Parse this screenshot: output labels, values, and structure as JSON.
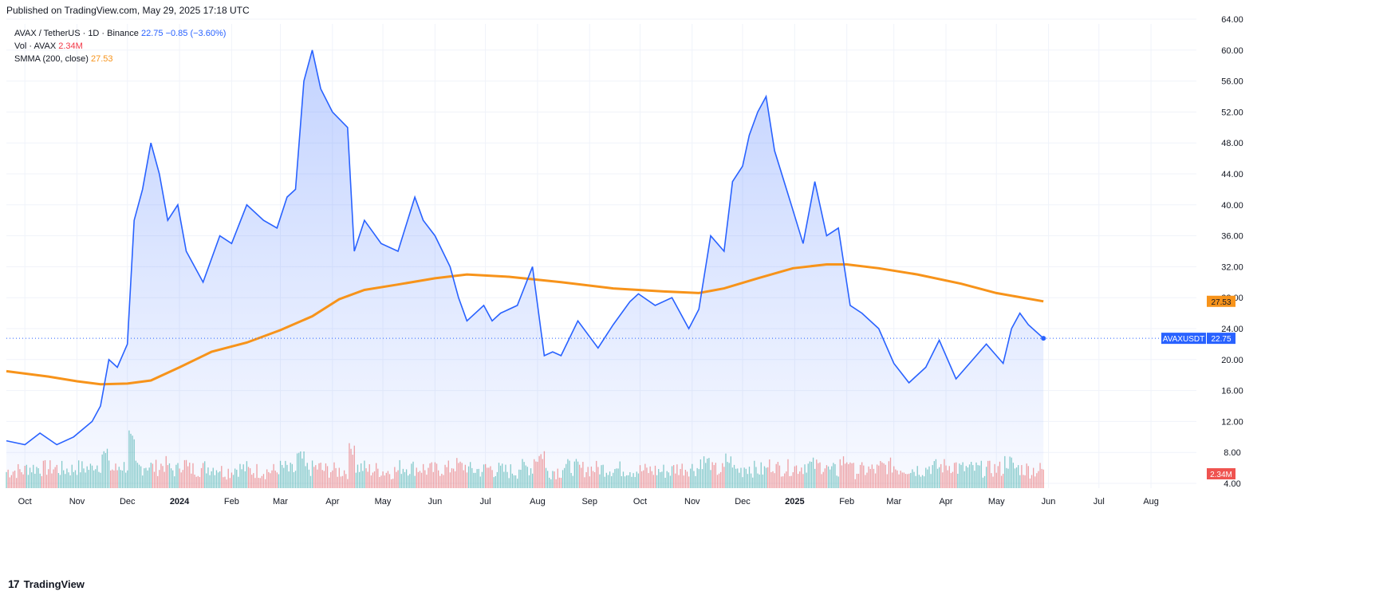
{
  "header": {
    "published": "Published on TradingView.com, May 29, 2025 17:18 UTC"
  },
  "legend": {
    "symbol": "AVAX / TetherUS · 1D · Binance",
    "price": "22.75",
    "change": "−0.85 (−3.60%)",
    "vol_label": "Vol · AVAX",
    "vol_value": "2.34M",
    "smma_label": "SMMA (200, close)",
    "smma_value": "27.53"
  },
  "branding": {
    "logo": "17",
    "name": "TradingView"
  },
  "colors": {
    "price_line": "#2962ff",
    "smma": "#f7931a",
    "vol_up": "#26a69a",
    "vol_down": "#ef5350",
    "grid": "#f0f3fa",
    "axis_text": "#131722"
  },
  "chart_data": {
    "type": "area",
    "symbol": "AVAXUSDT",
    "y_axis": {
      "ticks": [
        "64.00",
        "60.00",
        "56.00",
        "52.00",
        "48.00",
        "44.00",
        "40.00",
        "36.00",
        "32.00",
        "28.00",
        "24.00",
        "20.00",
        "16.00",
        "12.00",
        "8.00",
        "4.00"
      ],
      "ylim": [
        4,
        64
      ]
    },
    "x_axis": {
      "ticks": [
        "Oct",
        "Nov",
        "Dec",
        "2024",
        "Feb",
        "Mar",
        "Apr",
        "May",
        "Jun",
        "Jul",
        "Aug",
        "Sep",
        "Oct",
        "Nov",
        "Dec",
        "2025",
        "Feb",
        "Mar",
        "Apr",
        "May",
        "Jun",
        "Jul",
        "Aug"
      ],
      "tick_dates": [
        "2023-10-01",
        "2023-11-01",
        "2023-12-01",
        "2024-01-01",
        "2024-02-01",
        "2024-03-01",
        "2024-04-01",
        "2024-05-01",
        "2024-06-01",
        "2024-07-01",
        "2024-08-01",
        "2024-09-01",
        "2024-10-01",
        "2024-11-01",
        "2024-12-01",
        "2025-01-01",
        "2025-02-01",
        "2025-03-01",
        "2025-04-01",
        "2025-05-01",
        "2025-06-01",
        "2025-07-01",
        "2025-08-01"
      ],
      "range": [
        "2023-09-20",
        "2025-08-28"
      ]
    },
    "price_labels": {
      "current": "22.75",
      "ticker": "AVAXUSDT",
      "smma": "27.53",
      "volume": "2.34M"
    },
    "series": [
      {
        "name": "AVAX / TetherUS",
        "x": [
          "2023-09-20",
          "2023-10-01",
          "2023-10-10",
          "2023-10-20",
          "2023-10-30",
          "2023-11-10",
          "2023-11-15",
          "2023-11-20",
          "2023-11-25",
          "2023-12-01",
          "2023-12-05",
          "2023-12-10",
          "2023-12-15",
          "2023-12-20",
          "2023-12-25",
          "2023-12-31",
          "2024-01-05",
          "2024-01-15",
          "2024-01-25",
          "2024-02-01",
          "2024-02-10",
          "2024-02-20",
          "2024-02-28",
          "2024-03-05",
          "2024-03-10",
          "2024-03-15",
          "2024-03-20",
          "2024-03-25",
          "2024-04-01",
          "2024-04-10",
          "2024-04-14",
          "2024-04-20",
          "2024-04-30",
          "2024-05-10",
          "2024-05-20",
          "2024-05-25",
          "2024-06-01",
          "2024-06-10",
          "2024-06-15",
          "2024-06-20",
          "2024-06-30",
          "2024-07-05",
          "2024-07-10",
          "2024-07-20",
          "2024-07-29",
          "2024-08-05",
          "2024-08-10",
          "2024-08-15",
          "2024-08-25",
          "2024-09-06",
          "2024-09-15",
          "2024-09-25",
          "2024-09-30",
          "2024-10-10",
          "2024-10-20",
          "2024-10-30",
          "2024-11-05",
          "2024-11-12",
          "2024-11-20",
          "2024-11-25",
          "2024-12-01",
          "2024-12-05",
          "2024-12-10",
          "2024-12-15",
          "2024-12-20",
          "2024-12-30",
          "2025-01-06",
          "2025-01-13",
          "2025-01-20",
          "2025-01-27",
          "2025-02-03",
          "2025-02-10",
          "2025-02-20",
          "2025-03-01",
          "2025-03-10",
          "2025-03-20",
          "2025-03-28",
          "2025-04-07",
          "2025-04-15",
          "2025-04-25",
          "2025-05-05",
          "2025-05-10",
          "2025-05-15",
          "2025-05-20",
          "2025-05-29"
        ],
        "values": [
          9.5,
          9.0,
          10.5,
          9.0,
          10.0,
          12.0,
          14.0,
          20.0,
          19.0,
          22.0,
          38.0,
          42.0,
          48.0,
          44.0,
          38.0,
          40.0,
          34.0,
          30.0,
          36.0,
          35.0,
          40.0,
          38.0,
          37.0,
          41.0,
          42.0,
          56.0,
          60.0,
          55.0,
          52.0,
          50.0,
          34.0,
          38.0,
          35.0,
          34.0,
          41.0,
          38.0,
          36.0,
          32.0,
          28.0,
          25.0,
          27.0,
          25.0,
          26.0,
          27.0,
          32.0,
          20.5,
          21.0,
          20.5,
          25.0,
          21.5,
          24.5,
          27.5,
          28.5,
          27.0,
          28.0,
          24.0,
          26.5,
          36.0,
          34.0,
          43.0,
          45.0,
          49.0,
          52.0,
          54.0,
          47.0,
          40.0,
          35.0,
          43.0,
          36.0,
          37.0,
          27.0,
          26.0,
          24.0,
          19.5,
          17.0,
          19.0,
          22.5,
          17.5,
          19.5,
          22.0,
          19.5,
          24.0,
          26.0,
          24.5,
          22.75
        ]
      },
      {
        "name": "SMMA (200, close)",
        "x": [
          "2023-09-20",
          "2023-10-15",
          "2023-11-01",
          "2023-11-15",
          "2023-12-01",
          "2023-12-15",
          "2024-01-01",
          "2024-01-20",
          "2024-02-10",
          "2024-03-01",
          "2024-03-20",
          "2024-04-05",
          "2024-04-20",
          "2024-05-10",
          "2024-06-01",
          "2024-06-20",
          "2024-07-15",
          "2024-08-15",
          "2024-09-15",
          "2024-10-15",
          "2024-11-05",
          "2024-11-20",
          "2024-12-10",
          "2024-12-31",
          "2025-01-20",
          "2025-02-01",
          "2025-02-20",
          "2025-03-15",
          "2025-04-10",
          "2025-05-01",
          "2025-05-29"
        ],
        "values": [
          18.5,
          17.8,
          17.2,
          16.8,
          16.9,
          17.3,
          19.0,
          21.0,
          22.2,
          23.8,
          25.6,
          27.8,
          29.0,
          29.7,
          30.5,
          31.0,
          30.7,
          30.0,
          29.2,
          28.8,
          28.6,
          29.2,
          30.5,
          31.8,
          32.3,
          32.3,
          31.8,
          31.0,
          29.8,
          28.6,
          27.53
        ]
      }
    ],
    "volume": {
      "name": "Vol · AVAX",
      "unit": "M",
      "latest": 2.34
    }
  }
}
